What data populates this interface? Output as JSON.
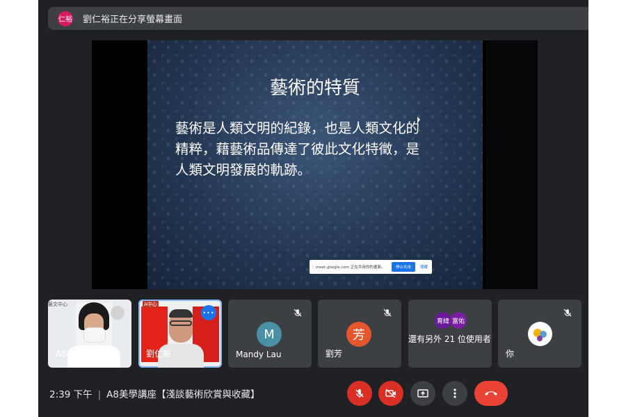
{
  "banner": {
    "avatar_text": "仁裕",
    "text": "劉仁裕正在分享螢幕畫面"
  },
  "slide": {
    "title": "藝術的特質",
    "body_lines": [
      "藝術是人類文明的紀錄，也是人類文化的",
      "精粹，藉藝術品傳達了彼此文化特徵，是",
      "人類文明發展的軌跡。"
    ]
  },
  "share_bar": {
    "text": "meet.google.com 正在共用你的畫面。",
    "stop_label": "停止共用",
    "hide_label": "隱藏"
  },
  "participants": [
    {
      "name": "A8時時",
      "corner_label": "藝文中心",
      "muted": true
    },
    {
      "name": "劉仁裕",
      "corner_label": "A中心",
      "speaking": true
    },
    {
      "name": "Mandy Lau",
      "avatar_letter": "M",
      "avatar_color": "#4a90a4",
      "muted": true
    },
    {
      "name": "劉芳",
      "avatar_letter": "芳",
      "avatar_color": "#e4572e",
      "muted": true
    },
    {
      "more_text": "還有另外 21 位使用者",
      "chips": [
        "育緯",
        "富佑"
      ]
    },
    {
      "name": "你",
      "muted": true
    }
  ],
  "meeting": {
    "time": "2:39 下午",
    "separator": "|",
    "title": "A8美學講座【淺談藝術欣賞與收藏】"
  },
  "colors": {
    "background": "#202124",
    "tile": "#3c4043",
    "danger": "#d93025",
    "accent": "#1a73e8"
  },
  "icons": {
    "mic": "mic-off-icon",
    "camera": "camera-off-icon",
    "present": "present-icon",
    "more": "more-vert-icon",
    "leave": "hang-up-icon"
  }
}
